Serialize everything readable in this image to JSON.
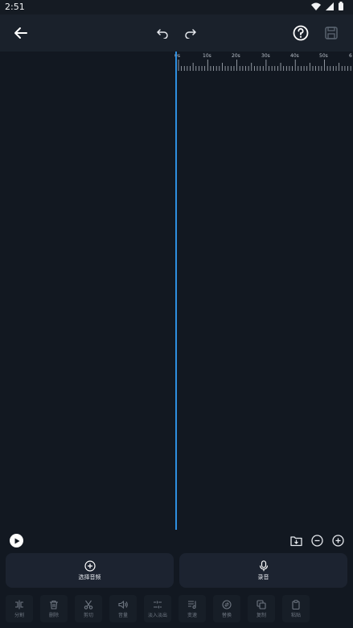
{
  "status_bar": {
    "time": "2:51"
  },
  "ruler": {
    "labels": [
      "0s",
      "10s",
      "20s",
      "30s",
      "40s",
      "50s",
      "6"
    ]
  },
  "actions": {
    "select_audio": "选择音频",
    "record": "录音"
  },
  "toolbar": {
    "items": [
      {
        "label": "分割",
        "icon": "split-icon"
      },
      {
        "label": "删除",
        "icon": "trash-icon"
      },
      {
        "label": "剪切",
        "icon": "scissors-icon"
      },
      {
        "label": "音量",
        "icon": "volume-icon"
      },
      {
        "label": "淡入淡出",
        "icon": "fade-icon"
      },
      {
        "label": "变速",
        "icon": "speed-icon"
      },
      {
        "label": "替换",
        "icon": "replace-icon"
      },
      {
        "label": "复制",
        "icon": "copy-icon"
      },
      {
        "label": "粘贴",
        "icon": "paste-icon"
      }
    ]
  },
  "colors": {
    "background": "#121821",
    "app_bar": "#1a212b",
    "playhead": "#2f8fe0",
    "card": "#1c2330"
  }
}
